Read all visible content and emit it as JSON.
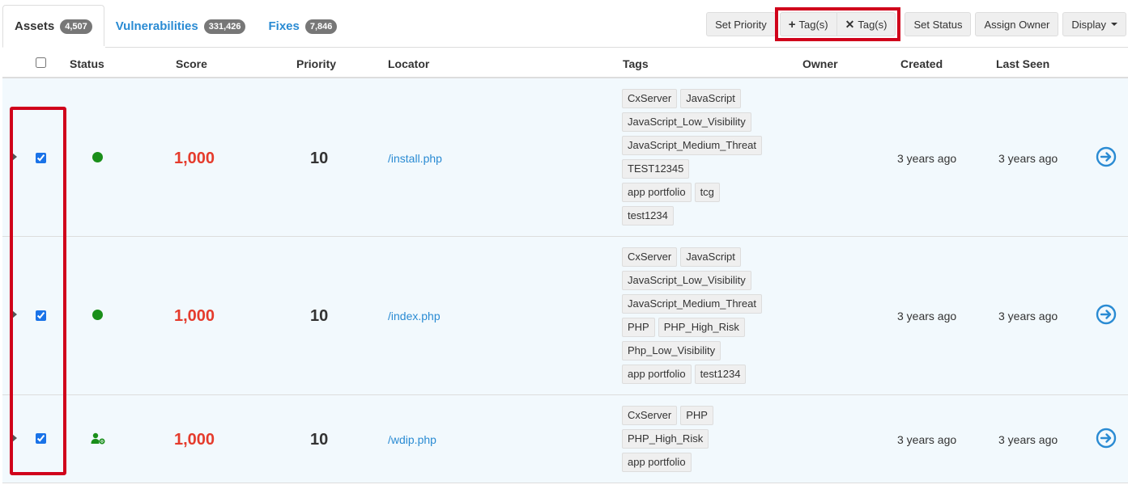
{
  "tabs": [
    {
      "label": "Assets",
      "count": "4,507"
    },
    {
      "label": "Vulnerabilities",
      "count": "331,426"
    },
    {
      "label": "Fixes",
      "count": "7,846"
    }
  ],
  "toolbar": {
    "set_priority": "Set Priority",
    "add_tags": "Tag(s)",
    "remove_tags": "Tag(s)",
    "set_status": "Set Status",
    "assign_owner": "Assign Owner",
    "display": "Display"
  },
  "columns": {
    "status": "Status",
    "score": "Score",
    "priority": "Priority",
    "locator": "Locator",
    "tags": "Tags",
    "owner": "Owner",
    "created": "Created",
    "last_seen": "Last Seen"
  },
  "rows": [
    {
      "score": "1,000",
      "priority": "10",
      "locator": "/install.php",
      "status_icon": "green-dot",
      "tags": [
        [
          "CxServer",
          "JavaScript"
        ],
        [
          "JavaScript_Low_Visibility"
        ],
        [
          "JavaScript_Medium_Threat"
        ],
        [
          "TEST12345"
        ],
        [
          "app portfolio",
          "tcg"
        ],
        [
          "test1234"
        ]
      ],
      "created": "3 years ago",
      "last_seen": "3 years ago"
    },
    {
      "score": "1,000",
      "priority": "10",
      "locator": "/index.php",
      "status_icon": "green-dot",
      "tags": [
        [
          "CxServer",
          "JavaScript"
        ],
        [
          "JavaScript_Low_Visibility"
        ],
        [
          "JavaScript_Medium_Threat"
        ],
        [
          "PHP",
          "PHP_High_Risk"
        ],
        [
          "Php_Low_Visibility"
        ],
        [
          "app portfolio",
          "test1234"
        ]
      ],
      "created": "3 years ago",
      "last_seen": "3 years ago"
    },
    {
      "score": "1,000",
      "priority": "10",
      "locator": "/wdip.php",
      "status_icon": "user-gear-icon",
      "tags": [
        [
          "CxServer",
          "PHP"
        ],
        [
          "PHP_High_Risk"
        ],
        [
          "app portfolio"
        ]
      ],
      "created": "3 years ago",
      "last_seen": "3 years ago"
    }
  ],
  "colors": {
    "accent": "#2a8bd3",
    "score": "#e53b2c",
    "status": "#1a8f1a",
    "highlight": "#d0021b"
  }
}
